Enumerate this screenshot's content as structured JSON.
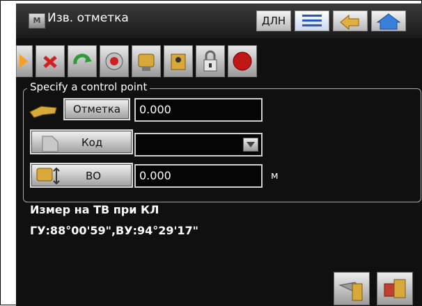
{
  "window": {
    "mode_badge": "M",
    "title": "Изв. отметка",
    "dln_label": "ДЛН"
  },
  "toolbar_icons": [
    "forward-arrow-icon",
    "delete-icon",
    "refresh-icon",
    "target-icon",
    "measure-icon",
    "lock-icon",
    "stop-icon"
  ],
  "group": {
    "legend": "Specify a control point",
    "elevation_button": "Отметка",
    "elevation_value": "0.000",
    "code_button": "Код",
    "code_value": "",
    "instrument_height_button": "ВО",
    "instrument_height_value": "0.000",
    "instrument_height_unit": "м"
  },
  "status": {
    "line1": "Измер на ТВ при КЛ",
    "line2": "ГУ:88°00'59\",ВУ:94°29'17\""
  },
  "colors": {
    "background": "#101010",
    "text": "#ffffff",
    "accent_icon": "#d8a93a"
  }
}
